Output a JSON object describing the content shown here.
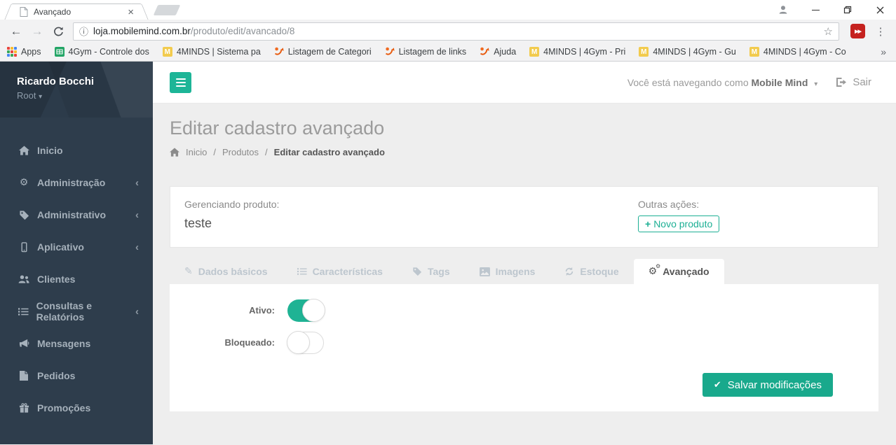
{
  "browser": {
    "tab_title": "Avançado",
    "url": {
      "domain": "loja.mobilemind.com.br",
      "path": "/produto/edit/avancado/8"
    },
    "bookmarks": [
      {
        "label": "Apps"
      },
      {
        "label": "4Gym - Controle dos"
      },
      {
        "label": "4MINDS | Sistema pa"
      },
      {
        "label": "Listagem de Categori"
      },
      {
        "label": "Listagem de links"
      },
      {
        "label": "Ajuda"
      },
      {
        "label": "4MINDS | 4Gym - Pri"
      },
      {
        "label": "4MINDS | 4Gym - Gu"
      },
      {
        "label": "4MINDS | 4Gym - Co"
      }
    ]
  },
  "icons": {
    "close": "×",
    "back": "←",
    "forward": "→",
    "info": "ⓘ",
    "star": "☆",
    "dots": "⋮",
    "overflow": "»",
    "caret_down": "▾",
    "chevron_left": "‹",
    "gear": "⚙",
    "pencil": "✎",
    "check": "✔",
    "plus": "+",
    "ext": "▶▶"
  },
  "sidebar": {
    "user": {
      "name": "Ricardo Bocchi",
      "role": "Root"
    },
    "items": [
      {
        "label": "Inicio"
      },
      {
        "label": "Administração"
      },
      {
        "label": "Administrativo"
      },
      {
        "label": "Aplicativo"
      },
      {
        "label": "Clientes"
      },
      {
        "label": "Consultas e Relatórios"
      },
      {
        "label": "Mensagens"
      },
      {
        "label": "Pedidos"
      },
      {
        "label": "Promoções"
      }
    ]
  },
  "header": {
    "navigating_as": "Você está navegando como",
    "impersonated_user": "Mobile Mind",
    "signout_label": "Sair"
  },
  "page": {
    "title": "Editar cadastro avançado",
    "breadcrumb": [
      "Inicio",
      "Produtos",
      "Editar cadastro avançado"
    ],
    "breadcrumb_separator": "/",
    "managing_label": "Gerenciando produto:",
    "product_name": "teste",
    "other_actions_label": "Outras ações:",
    "new_product_button": "Novo produto",
    "tabs": [
      {
        "label": "Dados básicos"
      },
      {
        "label": "Características"
      },
      {
        "label": "Tags"
      },
      {
        "label": "Imagens"
      },
      {
        "label": "Estoque"
      },
      {
        "label": "Avançado"
      }
    ],
    "form": {
      "fields": [
        {
          "label": "Ativo:",
          "state": "on"
        },
        {
          "label": "Bloqueado:",
          "state": "off"
        }
      ],
      "save_button": "Salvar modificações"
    }
  },
  "colors": {
    "accent": "#1caf94",
    "save_button": "#19a98c",
    "sidebar_bg": "#2e3d4c",
    "page_bg": "#eeeeee"
  }
}
